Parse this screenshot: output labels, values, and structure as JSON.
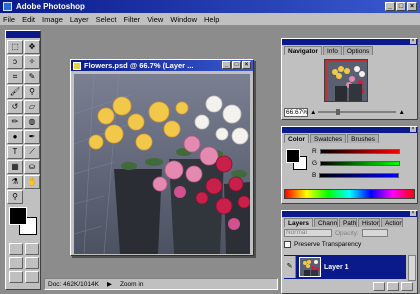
{
  "app": {
    "title": "Adobe Photoshop"
  },
  "window_buttons": [
    "_",
    "□",
    "×"
  ],
  "menu": [
    "File",
    "Edit",
    "Image",
    "Layer",
    "Select",
    "Filter",
    "View",
    "Window",
    "Help"
  ],
  "toolbox": {
    "tools": [
      {
        "name": "marquee-tool-icon",
        "glyph": "⬚"
      },
      {
        "name": "move-tool-icon",
        "glyph": "✥"
      },
      {
        "name": "lasso-tool-icon",
        "glyph": "ↄ"
      },
      {
        "name": "magic-wand-tool-icon",
        "glyph": "✧"
      },
      {
        "name": "crop-tool-icon",
        "glyph": "⌗"
      },
      {
        "name": "airbrush-tool-icon",
        "glyph": "✎"
      },
      {
        "name": "paintbrush-tool-icon",
        "glyph": "🖌"
      },
      {
        "name": "rubber-stamp-tool-icon",
        "glyph": "⚲"
      },
      {
        "name": "history-brush-tool-icon",
        "glyph": "↺"
      },
      {
        "name": "eraser-tool-icon",
        "glyph": "▱"
      },
      {
        "name": "pencil-tool-icon",
        "glyph": "✏"
      },
      {
        "name": "blur-tool-icon",
        "glyph": "◍"
      },
      {
        "name": "dodge-tool-icon",
        "glyph": "●"
      },
      {
        "name": "pen-tool-icon",
        "glyph": "✒"
      },
      {
        "name": "type-tool-icon",
        "glyph": "T"
      },
      {
        "name": "measure-tool-icon",
        "glyph": "⟋"
      },
      {
        "name": "gradient-tool-icon",
        "glyph": "▦"
      },
      {
        "name": "paint-bucket-tool-icon",
        "glyph": "⛀"
      },
      {
        "name": "eyedropper-tool-icon",
        "glyph": "⚗"
      },
      {
        "name": "hand-tool-icon",
        "glyph": "✋"
      },
      {
        "name": "zoom-tool-icon",
        "glyph": "⚲"
      }
    ]
  },
  "document": {
    "title": "Flowers.psd @ 66.7% (Layer ..."
  },
  "status": {
    "doc": "Doc: 462K/1014K",
    "zoom": "Zoom in"
  },
  "navigator": {
    "tabs": [
      "Navigator",
      "Info",
      "Options"
    ],
    "zoom": "66.67%"
  },
  "color_palette": {
    "tabs": [
      "Color",
      "Swatches",
      "Brushes"
    ],
    "channels": [
      "R",
      "G",
      "B"
    ]
  },
  "layers_palette": {
    "tabs": [
      "Layers",
      "Channels",
      "Paths",
      "History",
      "Actions"
    ],
    "mode": "Normal",
    "opacity_label": "Opacity:",
    "preserve_transparency": "Preserve Transparency",
    "layer_name": "Layer 1"
  },
  "colors": {
    "title_blue": "#0a1a8a",
    "face": "#c0c0c0",
    "workspace": "#8c8c8c"
  }
}
